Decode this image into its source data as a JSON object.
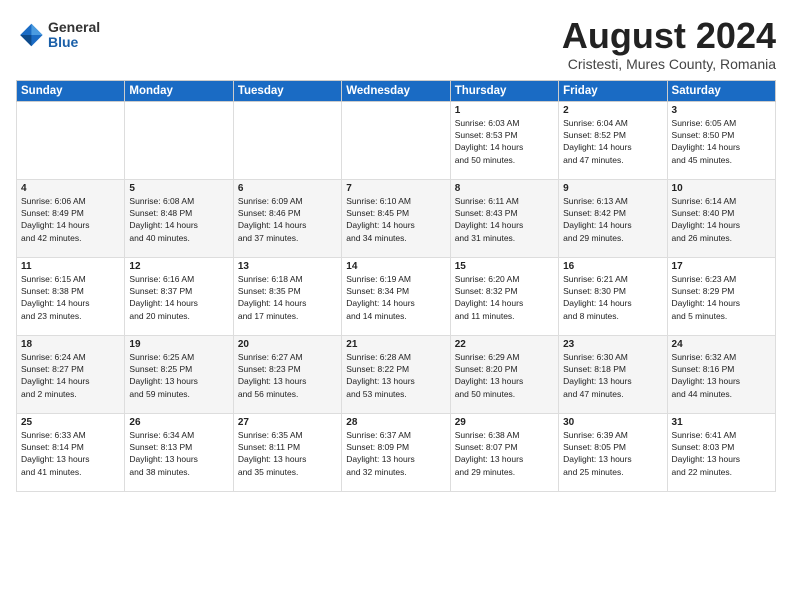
{
  "header": {
    "logo": {
      "general": "General",
      "blue": "Blue"
    },
    "title": "August 2024",
    "subtitle": "Cristesti, Mures County, Romania"
  },
  "weekdays": [
    "Sunday",
    "Monday",
    "Tuesday",
    "Wednesday",
    "Thursday",
    "Friday",
    "Saturday"
  ],
  "weeks": [
    [
      {
        "day": "",
        "info": ""
      },
      {
        "day": "",
        "info": ""
      },
      {
        "day": "",
        "info": ""
      },
      {
        "day": "",
        "info": ""
      },
      {
        "day": "1",
        "info": "Sunrise: 6:03 AM\nSunset: 8:53 PM\nDaylight: 14 hours\nand 50 minutes."
      },
      {
        "day": "2",
        "info": "Sunrise: 6:04 AM\nSunset: 8:52 PM\nDaylight: 14 hours\nand 47 minutes."
      },
      {
        "day": "3",
        "info": "Sunrise: 6:05 AM\nSunset: 8:50 PM\nDaylight: 14 hours\nand 45 minutes."
      }
    ],
    [
      {
        "day": "4",
        "info": "Sunrise: 6:06 AM\nSunset: 8:49 PM\nDaylight: 14 hours\nand 42 minutes."
      },
      {
        "day": "5",
        "info": "Sunrise: 6:08 AM\nSunset: 8:48 PM\nDaylight: 14 hours\nand 40 minutes."
      },
      {
        "day": "6",
        "info": "Sunrise: 6:09 AM\nSunset: 8:46 PM\nDaylight: 14 hours\nand 37 minutes."
      },
      {
        "day": "7",
        "info": "Sunrise: 6:10 AM\nSunset: 8:45 PM\nDaylight: 14 hours\nand 34 minutes."
      },
      {
        "day": "8",
        "info": "Sunrise: 6:11 AM\nSunset: 8:43 PM\nDaylight: 14 hours\nand 31 minutes."
      },
      {
        "day": "9",
        "info": "Sunrise: 6:13 AM\nSunset: 8:42 PM\nDaylight: 14 hours\nand 29 minutes."
      },
      {
        "day": "10",
        "info": "Sunrise: 6:14 AM\nSunset: 8:40 PM\nDaylight: 14 hours\nand 26 minutes."
      }
    ],
    [
      {
        "day": "11",
        "info": "Sunrise: 6:15 AM\nSunset: 8:38 PM\nDaylight: 14 hours\nand 23 minutes."
      },
      {
        "day": "12",
        "info": "Sunrise: 6:16 AM\nSunset: 8:37 PM\nDaylight: 14 hours\nand 20 minutes."
      },
      {
        "day": "13",
        "info": "Sunrise: 6:18 AM\nSunset: 8:35 PM\nDaylight: 14 hours\nand 17 minutes."
      },
      {
        "day": "14",
        "info": "Sunrise: 6:19 AM\nSunset: 8:34 PM\nDaylight: 14 hours\nand 14 minutes."
      },
      {
        "day": "15",
        "info": "Sunrise: 6:20 AM\nSunset: 8:32 PM\nDaylight: 14 hours\nand 11 minutes."
      },
      {
        "day": "16",
        "info": "Sunrise: 6:21 AM\nSunset: 8:30 PM\nDaylight: 14 hours\nand 8 minutes."
      },
      {
        "day": "17",
        "info": "Sunrise: 6:23 AM\nSunset: 8:29 PM\nDaylight: 14 hours\nand 5 minutes."
      }
    ],
    [
      {
        "day": "18",
        "info": "Sunrise: 6:24 AM\nSunset: 8:27 PM\nDaylight: 14 hours\nand 2 minutes."
      },
      {
        "day": "19",
        "info": "Sunrise: 6:25 AM\nSunset: 8:25 PM\nDaylight: 13 hours\nand 59 minutes."
      },
      {
        "day": "20",
        "info": "Sunrise: 6:27 AM\nSunset: 8:23 PM\nDaylight: 13 hours\nand 56 minutes."
      },
      {
        "day": "21",
        "info": "Sunrise: 6:28 AM\nSunset: 8:22 PM\nDaylight: 13 hours\nand 53 minutes."
      },
      {
        "day": "22",
        "info": "Sunrise: 6:29 AM\nSunset: 8:20 PM\nDaylight: 13 hours\nand 50 minutes."
      },
      {
        "day": "23",
        "info": "Sunrise: 6:30 AM\nSunset: 8:18 PM\nDaylight: 13 hours\nand 47 minutes."
      },
      {
        "day": "24",
        "info": "Sunrise: 6:32 AM\nSunset: 8:16 PM\nDaylight: 13 hours\nand 44 minutes."
      }
    ],
    [
      {
        "day": "25",
        "info": "Sunrise: 6:33 AM\nSunset: 8:14 PM\nDaylight: 13 hours\nand 41 minutes."
      },
      {
        "day": "26",
        "info": "Sunrise: 6:34 AM\nSunset: 8:13 PM\nDaylight: 13 hours\nand 38 minutes."
      },
      {
        "day": "27",
        "info": "Sunrise: 6:35 AM\nSunset: 8:11 PM\nDaylight: 13 hours\nand 35 minutes."
      },
      {
        "day": "28",
        "info": "Sunrise: 6:37 AM\nSunset: 8:09 PM\nDaylight: 13 hours\nand 32 minutes."
      },
      {
        "day": "29",
        "info": "Sunrise: 6:38 AM\nSunset: 8:07 PM\nDaylight: 13 hours\nand 29 minutes."
      },
      {
        "day": "30",
        "info": "Sunrise: 6:39 AM\nSunset: 8:05 PM\nDaylight: 13 hours\nand 25 minutes."
      },
      {
        "day": "31",
        "info": "Sunrise: 6:41 AM\nSunset: 8:03 PM\nDaylight: 13 hours\nand 22 minutes."
      }
    ]
  ]
}
